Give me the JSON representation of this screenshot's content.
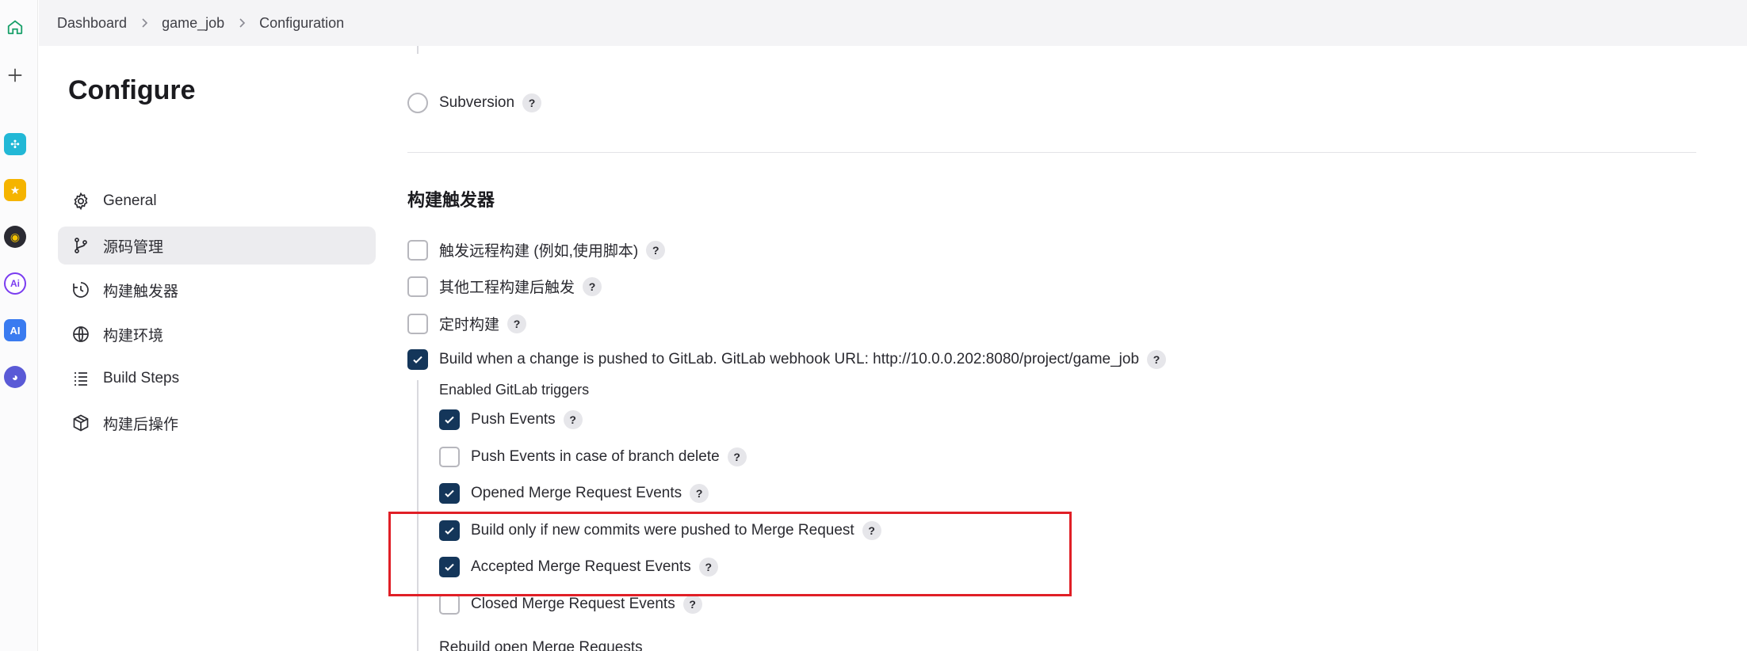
{
  "breadcrumb": [
    "Dashboard",
    "game_job",
    "Configuration"
  ],
  "rail": {
    "home_icon": "home-icon",
    "add_icon": "plus-icon",
    "apps": [
      {
        "name": "app-icon-1",
        "color": "#22b8d6",
        "glyph": "✣"
      },
      {
        "name": "app-icon-2",
        "color": "#f5b400",
        "glyph": "★"
      },
      {
        "name": "app-icon-3",
        "color": "#2b2b33",
        "glyph": "◉"
      },
      {
        "name": "app-icon-4",
        "color": "#7a3cf0",
        "glyph": "Ai"
      },
      {
        "name": "app-icon-5",
        "color": "#3a7bf0",
        "glyph": "AI"
      },
      {
        "name": "app-icon-6",
        "color": "#5a5ad6",
        "glyph": "◕"
      }
    ]
  },
  "page_title": "Configure",
  "nav": [
    {
      "label": "General",
      "icon": "gear-icon",
      "active": false
    },
    {
      "label": "源码管理",
      "icon": "branch-icon",
      "active": true
    },
    {
      "label": "构建触发器",
      "icon": "clock-icon",
      "active": false
    },
    {
      "label": "构建环境",
      "icon": "globe-icon",
      "active": false
    },
    {
      "label": "Build Steps",
      "icon": "list-icon",
      "active": false
    },
    {
      "label": "构建后操作",
      "icon": "package-icon",
      "active": false
    }
  ],
  "scm": {
    "subversion_label": "Subversion"
  },
  "triggers": {
    "section_title": "构建触发器",
    "items": [
      {
        "label": "触发远程构建 (例如,使用脚本)",
        "checked": false
      },
      {
        "label": "其他工程构建后触发",
        "checked": false
      },
      {
        "label": "定时构建",
        "checked": false
      },
      {
        "label": "Build when a change is pushed to GitLab. GitLab webhook URL: http://10.0.0.202:8080/project/game_job",
        "checked": true
      }
    ],
    "gitlab_label": "Enabled GitLab triggers",
    "gitlab_items": [
      {
        "label": "Push Events",
        "checked": true
      },
      {
        "label": "Push Events in case of branch delete",
        "checked": false
      },
      {
        "label": "Opened Merge Request Events",
        "checked": true
      },
      {
        "label": "Build only if new commits were pushed to Merge Request",
        "checked": true
      },
      {
        "label": "Accepted Merge Request Events",
        "checked": true
      },
      {
        "label": "Closed Merge Request Events",
        "checked": false
      }
    ],
    "partial_label": "Rebuild open Merge Requests"
  },
  "help_glyph": "?",
  "colors": {
    "checked": "#14365a",
    "highlight": "#e01f26"
  }
}
